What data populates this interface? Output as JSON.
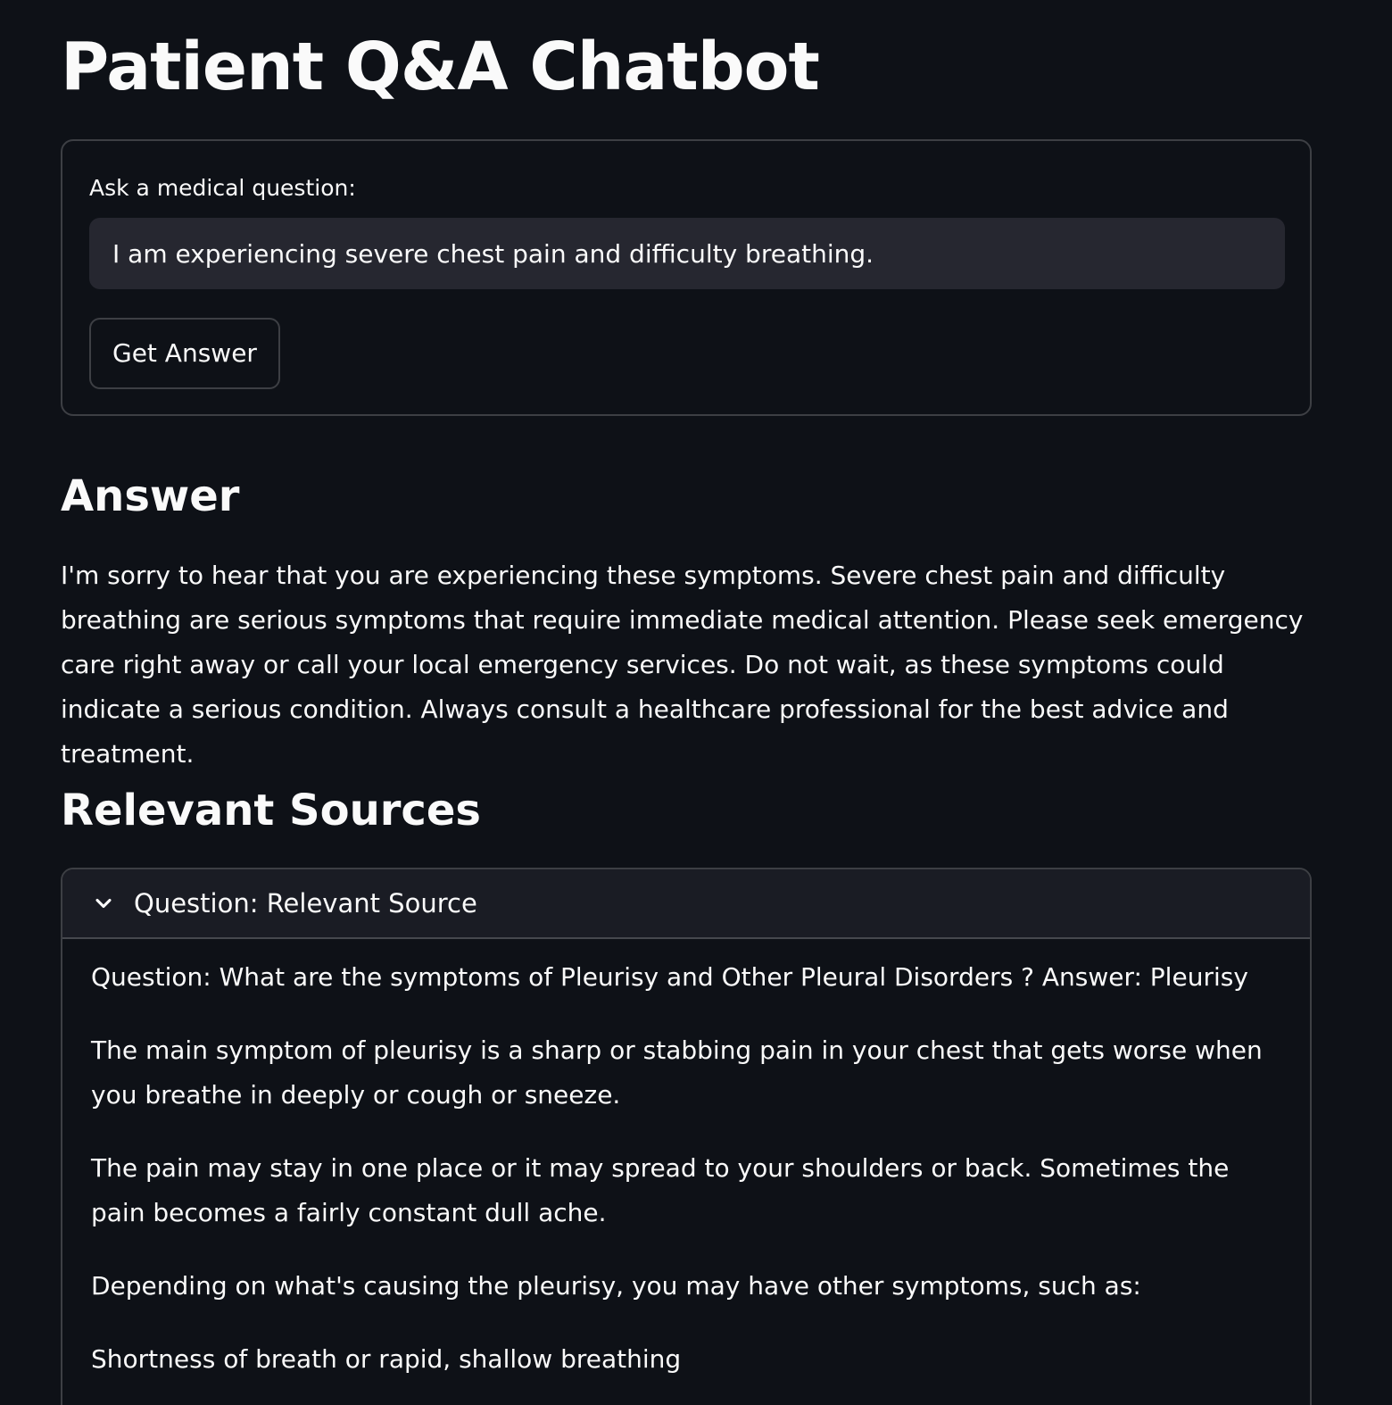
{
  "page": {
    "title": "Patient Q&A Chatbot"
  },
  "form": {
    "label": "Ask a medical question:",
    "input_value": "I am experiencing severe chest pain and difficulty breathing.",
    "button_label": "Get Answer"
  },
  "answer": {
    "heading": "Answer",
    "text": "I'm sorry to hear that you are experiencing these symptoms. Severe chest pain and difficulty breathing are serious symptoms that require immediate medical attention. Please seek emergency care right away or call your local emergency services. Do not wait, as these symptoms could indicate a serious condition. Always consult a healthcare professional for the best advice and treatment."
  },
  "sources": {
    "heading": "Relevant Sources",
    "expander_title": "Question: Relevant Source",
    "expander_icon": "chevron-down-icon",
    "paragraphs": [
      "Question: What are the symptoms of Pleurisy and Other Pleural Disorders ? Answer: Pleurisy",
      "The main symptom of pleurisy is a sharp or stabbing pain in your chest that gets worse when you breathe in deeply or cough or sneeze.",
      "The pain may stay in one place or it may spread to your shoulders or back. Sometimes the pain becomes a fairly constant dull ache.",
      "Depending on what's causing the pleurisy, you may have other symptoms, such as:",
      "Shortness of breath or rapid, shallow breathing"
    ]
  }
}
